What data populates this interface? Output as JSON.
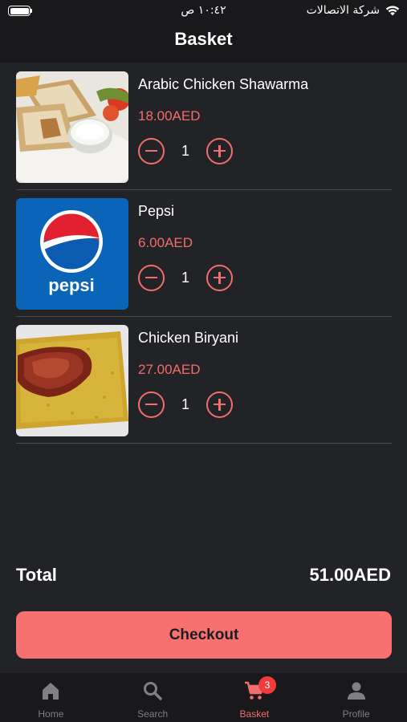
{
  "status_bar": {
    "time": "١٠:٤٢ ص",
    "carrier": "شركة الاتصالات"
  },
  "header": {
    "title": "Basket"
  },
  "items": [
    {
      "name": "Arabic Chicken Shawarma",
      "price": "18.00AED",
      "quantity": "1",
      "image_icon": "shawarma-image"
    },
    {
      "name": "Pepsi",
      "price": "6.00AED",
      "quantity": "1",
      "image_icon": "pepsi-image",
      "logo_text": "pepsi"
    },
    {
      "name": "Chicken Biryani",
      "price": "27.00AED",
      "quantity": "1",
      "image_icon": "biryani-image"
    }
  ],
  "summary": {
    "total_label": "Total",
    "total_value": "51.00AED"
  },
  "checkout_label": "Checkout",
  "tabs": [
    {
      "label": "Home",
      "icon": "home-icon",
      "active": false
    },
    {
      "label": "Search",
      "icon": "search-icon",
      "active": false
    },
    {
      "label": "Basket",
      "icon": "cart-icon",
      "active": true,
      "badge": "3"
    },
    {
      "label": "Profile",
      "icon": "profile-icon",
      "active": false
    }
  ],
  "colors": {
    "background": "#222326",
    "bar": "#19191b",
    "accent": "#f26d6d",
    "checkout": "#f77170",
    "badge": "#f23b3b"
  }
}
